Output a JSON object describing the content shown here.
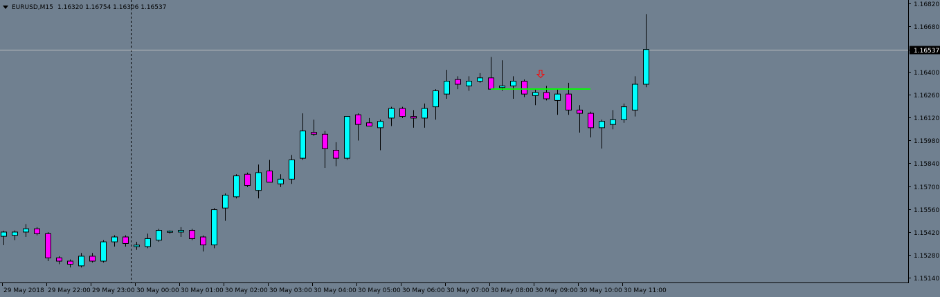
{
  "header": {
    "symbol": "EURUSD,M15",
    "ohlc": "1.16320 1.16754 1.16306 1.16537"
  },
  "colors": {
    "background": "#708090",
    "bull": "#00FFFF",
    "bear": "#FF00FF",
    "wick": "#000000",
    "bid_line": "#C0C0C0",
    "trend_line": "#00FF00",
    "arrow": "#FF0000"
  },
  "chart_data": {
    "type": "candlestick",
    "timeframe": "M15",
    "ylim": [
      1.1511,
      1.1684
    ],
    "current_price": "1.16537",
    "y_ticks": [
      "1.16820",
      "1.16680",
      "1.16537",
      "1.16400",
      "1.16260",
      "1.16120",
      "1.15980",
      "1.15840",
      "1.15700",
      "1.15560",
      "1.15420",
      "1.15280",
      "1.15140"
    ],
    "x_ticks": [
      {
        "bar": 0,
        "label": "29 May 2018"
      },
      {
        "bar": 4,
        "label": "29 May 22:00"
      },
      {
        "bar": 8,
        "label": "29 May 23:00"
      },
      {
        "bar": 12,
        "label": "30 May 00:00"
      },
      {
        "bar": 16,
        "label": "30 May 01:00"
      },
      {
        "bar": 20,
        "label": "30 May 02:00"
      },
      {
        "bar": 24,
        "label": "30 May 03:00"
      },
      {
        "bar": 28,
        "label": "30 May 04:00"
      },
      {
        "bar": 32,
        "label": "30 May 05:00"
      },
      {
        "bar": 36,
        "label": "30 May 06:00"
      },
      {
        "bar": 40,
        "label": "30 May 07:00"
      },
      {
        "bar": 44,
        "label": "30 May 08:00"
      },
      {
        "bar": 48,
        "label": "30 May 09:00"
      },
      {
        "bar": 52,
        "label": "30 May 10:00"
      },
      {
        "bar": 56,
        "label": "30 May 11:00"
      }
    ],
    "separator_bar": 11.5,
    "trend_line": {
      "from_bar": 44,
      "to_bar": 53,
      "price": 1.16295
    },
    "arrow_marker": {
      "bar": 48.5,
      "price": 1.16368,
      "direction": "down"
    },
    "candles": [
      [
        1.15393,
        1.15427,
        1.15339,
        1.15419
      ],
      [
        1.15399,
        1.15429,
        1.15369,
        1.15419
      ],
      [
        1.15419,
        1.15468,
        1.15389,
        1.15439
      ],
      [
        1.15439,
        1.15449,
        1.15399,
        1.15409
      ],
      [
        1.15409,
        1.15419,
        1.15241,
        1.15261
      ],
      [
        1.15261,
        1.15271,
        1.15222,
        1.15241
      ],
      [
        1.15241,
        1.15251,
        1.15202,
        1.15222
      ],
      [
        1.15212,
        1.15291,
        1.15202,
        1.15271
      ],
      [
        1.15271,
        1.15291,
        1.15232,
        1.15241
      ],
      [
        1.15241,
        1.15369,
        1.15232,
        1.15359
      ],
      [
        1.15359,
        1.15399,
        1.1533,
        1.15389
      ],
      [
        1.15389,
        1.15399,
        1.1533,
        1.15349
      ],
      [
        1.1533,
        1.15359,
        1.1531,
        1.15339
      ],
      [
        1.1533,
        1.15409,
        1.1532,
        1.15379
      ],
      [
        1.15369,
        1.15439,
        1.15359,
        1.15429
      ],
      [
        1.15419,
        1.15429,
        1.15409,
        1.15424
      ],
      [
        1.15419,
        1.15449,
        1.15389,
        1.15429
      ],
      [
        1.15429,
        1.15439,
        1.15369,
        1.15379
      ],
      [
        1.15389,
        1.15398,
        1.153,
        1.1534
      ],
      [
        1.1534,
        1.15566,
        1.1532,
        1.15556
      ],
      [
        1.15566,
        1.15655,
        1.15488,
        1.15645
      ],
      [
        1.15635,
        1.15773,
        1.15625,
        1.15763
      ],
      [
        1.15773,
        1.15783,
        1.15694,
        1.15704
      ],
      [
        1.15674,
        1.15832,
        1.15625,
        1.15783
      ],
      [
        1.15793,
        1.15861,
        1.15724,
        1.15724
      ],
      [
        1.15714,
        1.15773,
        1.15694,
        1.15743
      ],
      [
        1.15743,
        1.15891,
        1.15714,
        1.15861
      ],
      [
        1.15871,
        1.16146,
        1.15861,
        1.16038
      ],
      [
        1.16029,
        1.16107,
        1.16008,
        1.16018
      ],
      [
        1.16018,
        1.16038,
        1.15812,
        1.1593
      ],
      [
        1.1592,
        1.15969,
        1.15822,
        1.15871
      ],
      [
        1.15871,
        1.16127,
        1.15861,
        1.16127
      ],
      [
        1.16137,
        1.16146,
        1.15979,
        1.16078
      ],
      [
        1.16088,
        1.16117,
        1.16068,
        1.16068
      ],
      [
        1.16058,
        1.16107,
        1.1592,
        1.16097
      ],
      [
        1.16117,
        1.16186,
        1.16068,
        1.16176
      ],
      [
        1.16176,
        1.16186,
        1.16117,
        1.16127
      ],
      [
        1.16127,
        1.16166,
        1.16058,
        1.16117
      ],
      [
        1.16117,
        1.16206,
        1.16058,
        1.16176
      ],
      [
        1.16186,
        1.16294,
        1.16107,
        1.16284
      ],
      [
        1.16264,
        1.16412,
        1.16235,
        1.16343
      ],
      [
        1.16353,
        1.16373,
        1.16294,
        1.16324
      ],
      [
        1.16314,
        1.16373,
        1.16284,
        1.16343
      ],
      [
        1.16343,
        1.16392,
        1.16333,
        1.16363
      ],
      [
        1.16363,
        1.16491,
        1.16294,
        1.16294
      ],
      [
        1.16304,
        1.16471,
        1.16284,
        1.16314
      ],
      [
        1.16314,
        1.16373,
        1.16235,
        1.16343
      ],
      [
        1.16343,
        1.16353,
        1.16245,
        1.16264
      ],
      [
        1.16255,
        1.16294,
        1.16196,
        1.16274
      ],
      [
        1.16274,
        1.16314,
        1.16225,
        1.16235
      ],
      [
        1.16225,
        1.16294,
        1.16137,
        1.16264
      ],
      [
        1.16264,
        1.16333,
        1.16137,
        1.16166
      ],
      [
        1.16166,
        1.16196,
        1.16028,
        1.16146
      ],
      [
        1.16146,
        1.16156,
        1.15999,
        1.16058
      ],
      [
        1.16058,
        1.16107,
        1.1593,
        1.16097
      ],
      [
        1.16078,
        1.16166,
        1.16048,
        1.16107
      ],
      [
        1.16107,
        1.16206,
        1.16088,
        1.16186
      ],
      [
        1.16166,
        1.16373,
        1.16127,
        1.16324
      ],
      [
        1.16324,
        1.16754,
        1.16306,
        1.16537
      ]
    ]
  }
}
